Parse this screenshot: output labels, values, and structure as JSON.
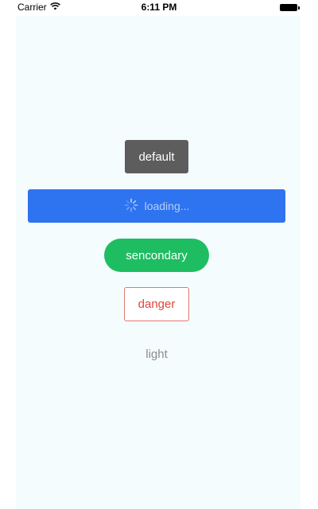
{
  "status_bar": {
    "carrier": "Carrier",
    "time": "6:11 PM",
    "wifi_icon": "wifi-icon",
    "battery_icon": "battery-icon"
  },
  "buttons": {
    "default": {
      "label": "default"
    },
    "loading": {
      "label": "loading...",
      "icon": "spinner-icon"
    },
    "secondary": {
      "label": "sencondary"
    },
    "danger": {
      "label": "danger"
    },
    "light": {
      "label": "light"
    }
  },
  "colors": {
    "screen_background": "#f5fcfd",
    "default": "#5d5d5d",
    "primary": "#2e73f0",
    "secondary": "#1fbd62",
    "danger": "#e0453a",
    "light_text": "#8c8c8c"
  }
}
